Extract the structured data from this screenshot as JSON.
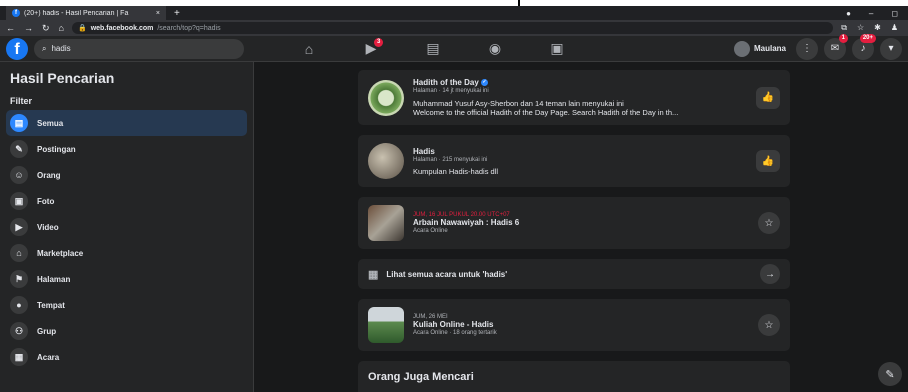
{
  "browser": {
    "tab_title": "(20+) hadis - Hasil Pencarian | Fa",
    "tab_close": "×",
    "new_tab": "+",
    "url_host": "web.facebook.com",
    "url_path": "/search/top?q=hadis"
  },
  "fb": {
    "logo": "f",
    "search_value": "hadis",
    "profile_name": "Maulana",
    "watch_badge": "3",
    "messenger_badge": "1",
    "notif_badge": "20+"
  },
  "sidebar": {
    "title": "Hasil Pencarian",
    "filter_label": "Filter",
    "items": [
      {
        "label": "Semua",
        "icon": "feed-icon",
        "glyph": "▤"
      },
      {
        "label": "Postingan",
        "icon": "post-icon",
        "glyph": "✎"
      },
      {
        "label": "Orang",
        "icon": "people-icon",
        "glyph": "☺"
      },
      {
        "label": "Foto",
        "icon": "photo-icon",
        "glyph": "▣"
      },
      {
        "label": "Video",
        "icon": "video-icon",
        "glyph": "▶"
      },
      {
        "label": "Marketplace",
        "icon": "shop-icon",
        "glyph": "⌂"
      },
      {
        "label": "Halaman",
        "icon": "flag-icon",
        "glyph": "⚑"
      },
      {
        "label": "Tempat",
        "icon": "pin-icon",
        "glyph": "●"
      },
      {
        "label": "Grup",
        "icon": "group-icon",
        "glyph": "⚇"
      },
      {
        "label": "Acara",
        "icon": "calendar-icon",
        "glyph": "▦"
      }
    ]
  },
  "results": {
    "r1": {
      "name": "Hadith of the Day",
      "sub": "Halaman · 14 jt menyukai ini",
      "desc1": "Muhammad Yusuf Asy-Sherbon dan 14 teman lain menyukai ini",
      "desc2": "Welcome to the official Hadith of the Day Page. Search Hadith of the Day in th..."
    },
    "r2": {
      "name": "Hadis",
      "sub": "Halaman · 215 menyukai ini",
      "desc": "Kumpulan Hadis-hadis dll"
    },
    "r3": {
      "date": "JUM, 16 JUL PUKUL 20.00 UTC+07",
      "name": "Arbain Nawawiyah : Hadis 6",
      "sub": "Acara Online"
    },
    "see_all": "Lihat semua acara untuk 'hadis'",
    "r4": {
      "date": "JUM, 26 MEI",
      "name": "Kuliah Online - Hadis",
      "sub": "Acara Online · 18 orang tertarik"
    },
    "people_title": "Orang Juga Mencari"
  }
}
